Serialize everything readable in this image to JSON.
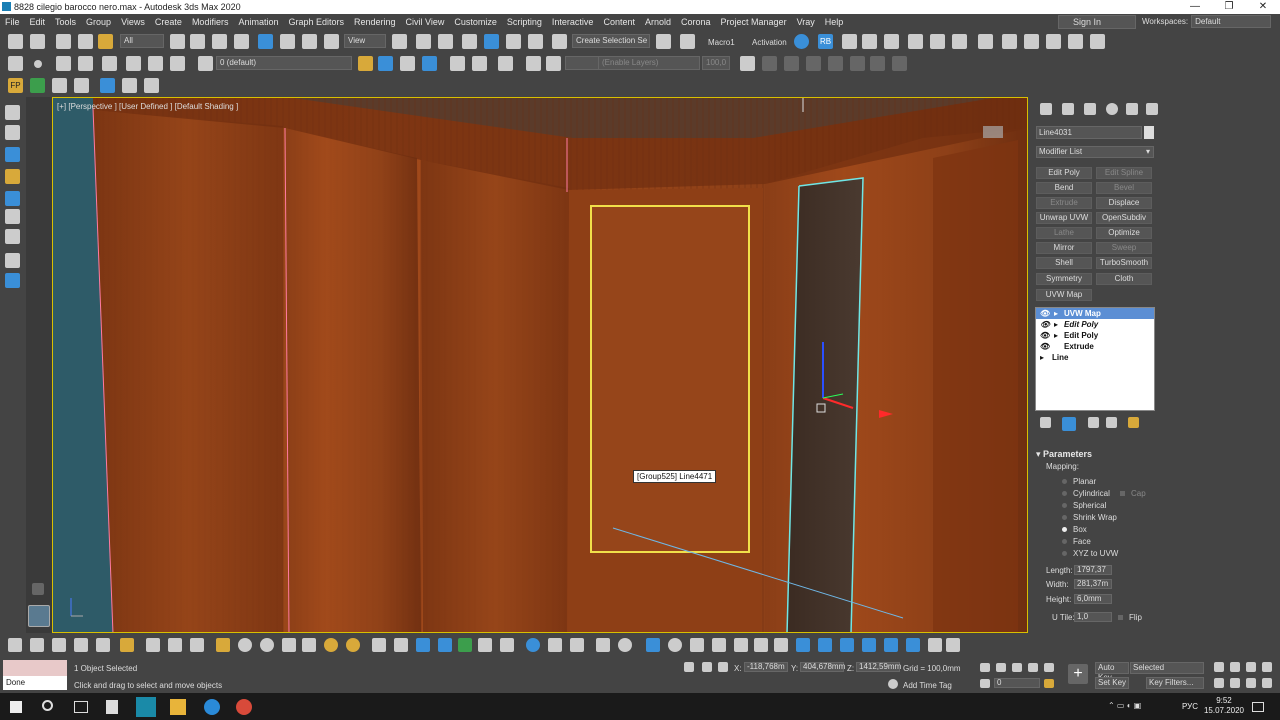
{
  "window": {
    "title": "8828 cilegio barocco nero.max - Autodesk 3ds Max 2020"
  },
  "menu": [
    "File",
    "Edit",
    "Tools",
    "Group",
    "Views",
    "Create",
    "Modifiers",
    "Animation",
    "Graph Editors",
    "Rendering",
    "Civil View",
    "Customize",
    "Scripting",
    "Interactive",
    "Content",
    "Arnold",
    "Corona",
    "Project Manager",
    "Vray",
    "Help"
  ],
  "account": {
    "sign_in": "Sign In",
    "workspaces_label": "Workspaces:",
    "workspace": "Default"
  },
  "toolbar": {
    "selection_filter": "All",
    "ref_coord": "View",
    "create_selection_set": "Create Selection Se",
    "macro": "Macro1",
    "activation": "Activation",
    "rb": "RB",
    "layer": "0 (default)",
    "enable_layers": "(Enable Layers)",
    "value_field": "100,0"
  },
  "viewport": {
    "label": "[+] [Perspective ] [User Defined ] [Default Shading ]",
    "tooltip": "[Group525] Line4471"
  },
  "command_panel": {
    "object_name": "Line4031",
    "modifier_list": "Modifier List",
    "buttons": [
      {
        "label": "Edit Poly",
        "enabled": true
      },
      {
        "label": "Edit Spline",
        "enabled": false
      },
      {
        "label": "Bend",
        "enabled": true
      },
      {
        "label": "Bevel",
        "enabled": false
      },
      {
        "label": "Extrude",
        "enabled": false
      },
      {
        "label": "Displace",
        "enabled": true
      },
      {
        "label": "Unwrap UVW",
        "enabled": true
      },
      {
        "label": "OpenSubdiv",
        "enabled": true
      },
      {
        "label": "Lathe",
        "enabled": false
      },
      {
        "label": "Optimize",
        "enabled": true
      },
      {
        "label": "Mirror",
        "enabled": true
      },
      {
        "label": "Sweep",
        "enabled": false
      },
      {
        "label": "Shell",
        "enabled": true
      },
      {
        "label": "TurboSmooth",
        "enabled": true
      },
      {
        "label": "Symmetry",
        "enabled": true
      },
      {
        "label": "Cloth",
        "enabled": true
      },
      {
        "label": "UVW Map",
        "enabled": true
      }
    ],
    "stack": [
      {
        "label": "UVW Map",
        "selected": true,
        "italic": false
      },
      {
        "label": "Edit Poly",
        "selected": false,
        "italic": true
      },
      {
        "label": "Edit Poly",
        "selected": false,
        "italic": false
      },
      {
        "label": "Extrude",
        "selected": false,
        "italic": false
      },
      {
        "label": "Line",
        "selected": false,
        "italic": false
      }
    ],
    "parameters": {
      "title": "Parameters",
      "mapping_label": "Mapping:",
      "options": [
        "Planar",
        "Cylindrical",
        "Spherical",
        "Shrink Wrap",
        "Box",
        "Face",
        "XYZ to UVW"
      ],
      "selected": "Box",
      "cap_label": "Cap",
      "length_label": "Length:",
      "length": "1797,37",
      "width_label": "Width:",
      "width": "281,37m",
      "height_label": "Height:",
      "height": "6,0mm",
      "utile_label": "U Tile:",
      "utile": "1,0",
      "flip_label": "Flip"
    }
  },
  "status": {
    "prompt_field": "Done",
    "selection": "1 Object Selected",
    "hint": "Click and drag to select and move objects",
    "x_label": "X:",
    "x": "-118,768m",
    "y_label": "Y:",
    "y": "404,678mm",
    "z_label": "Z:",
    "z": "1412,59mm",
    "grid": "Grid = 100,0mm",
    "add_time_tag": "Add Time Tag",
    "frame": "0",
    "auto_key": "Auto Key",
    "set_key": "Set Key",
    "key_mode": "Selected",
    "key_filters": "Key Filters..."
  },
  "taskbar": {
    "lang": "РУС",
    "time": "9:52",
    "date": "15.07.2020"
  },
  "colors": {
    "accent": "#5b8ed4",
    "viewport_border": "#d8c000",
    "wood": "#7a3512"
  }
}
